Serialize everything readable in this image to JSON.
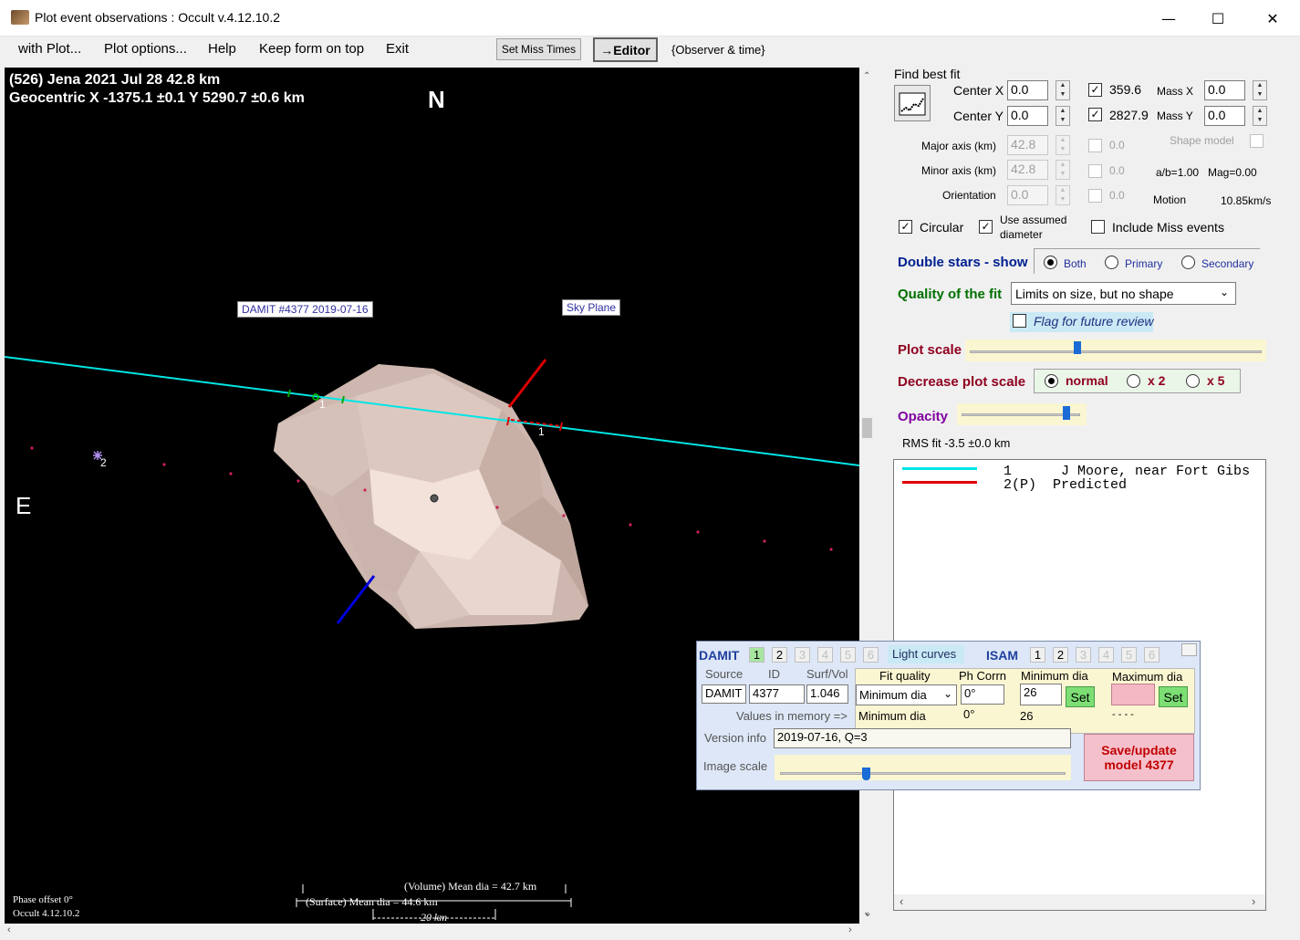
{
  "window": {
    "title": "Plot event observations : Occult v.4.12.10.2",
    "minimize": "—",
    "maximize": "☐",
    "close": "✕"
  },
  "menu": {
    "with_plot": "with Plot...",
    "plot_options": "Plot options...",
    "help": "Help",
    "keep_on_top": "Keep form on top",
    "exit": "Exit",
    "set_miss_times": "Set Miss Times",
    "editor": "→Editor",
    "observer_time": "{Observer & time}"
  },
  "plot": {
    "header_line1": "(526) Jena  2021 Jul 28   42.8 km",
    "header_line2": "Geocentric  X  -1375.1 ±0.1  Y 5290.7 ±0.6 km",
    "north": "N",
    "east": "E",
    "damit_label": "DAMIT #4377 2019-07-16",
    "sky_plane_label": "Sky Plane",
    "chord1_label": "1",
    "chord1_label_b": "1",
    "star2_label": "2",
    "volume_dia": "(Volume) Mean dia = 42.7 km",
    "surface_dia": "(Surface) Mean dia = 44.6 km",
    "scale_20km": "20 km",
    "phase_offset": "Phase offset 0°",
    "occult_version": "Occult 4.12.10.2",
    "colors": {
      "chord1": "#00e5e5",
      "predicted": "#e00000",
      "shape": "#ddc8c0"
    }
  },
  "right": {
    "find_best_fit": "Find best fit",
    "center_x_label": "Center X",
    "center_x": "0.0",
    "center_y_label": "Center Y",
    "center_y": "0.0",
    "chk_x_val": "359.6",
    "chk_y_val": "2827.9",
    "mass_x_label": "Mass X",
    "mass_x": "0.0",
    "mass_y_label": "Mass Y",
    "mass_y": "0.0",
    "major_label": "Major axis (km)",
    "major": "42.8",
    "minor_label": "Minor axis (km)",
    "minor": "42.8",
    "orient_label": "Orientation",
    "orient": "0.0",
    "dis_val1": "0.0",
    "dis_val2": "0.0",
    "dis_val3": "0.0",
    "shape_model": "Shape model",
    "ab_ratio": "a/b=1.00",
    "mag": "Mag=0.00",
    "motion_label": "Motion",
    "motion": "10.85km/s",
    "circular": "Circular",
    "use_assumed": "Use assumed",
    "diameter": "diameter",
    "include_miss": "Include Miss events",
    "double_stars": "Double stars - show",
    "both": "Both",
    "primary": "Primary",
    "secondary": "Secondary",
    "quality_label": "Quality of the fit",
    "quality_value": "Limits on size, but no shape",
    "flag_review": "Flag for future review",
    "plot_scale": "Plot scale",
    "plot_scale_level": 0.36,
    "decrease_scale": "Decrease plot scale",
    "normal": "normal",
    "x2": "x 2",
    "x5": "x 5",
    "opacity": "Opacity",
    "opacity_level": 0.88,
    "rms_fit": "RMS fit -3.5 ±0.0 km"
  },
  "observers": [
    {
      "num": "1",
      "text": "J Moore, near Fort Gibs",
      "color": "#00e5e5"
    },
    {
      "num": "2(P)",
      "text": "Predicted",
      "color": "#e00000"
    }
  ],
  "damit": {
    "damit_label": "DAMIT",
    "models": [
      "1",
      "2",
      "3",
      "4",
      "5",
      "6"
    ],
    "light_curves": "Light curves",
    "isam_label": "ISAM",
    "isam_models": [
      "1",
      "2",
      "3",
      "4",
      "5",
      "6"
    ],
    "source_hdr": "Source",
    "id_hdr": "ID",
    "surfvol_hdr": "Surf/Vol",
    "fit_quality_hdr": "Fit quality",
    "ph_corr_hdr": "Ph Corrn",
    "min_dia_hdr": "Minimum dia",
    "max_dia_hdr": "Maximum dia",
    "source": "DAMIT",
    "id": "4377",
    "surfvol": "1.046",
    "fit_quality": "Minimum dia",
    "ph_corr": "0°",
    "min_dia": "26",
    "set": "Set",
    "set2": "Set",
    "values_in_memory": "Values in memory =>",
    "mem_fit": "Minimum dia",
    "mem_ph": "0°",
    "mem_min": "26",
    "mem_max": "- - - -",
    "version_label": "Version info",
    "version": "2019-07-16, Q=3",
    "image_scale": "Image scale",
    "image_scale_level": 0.29,
    "save_line1": "Save/update",
    "save_line2": "model 4377"
  }
}
